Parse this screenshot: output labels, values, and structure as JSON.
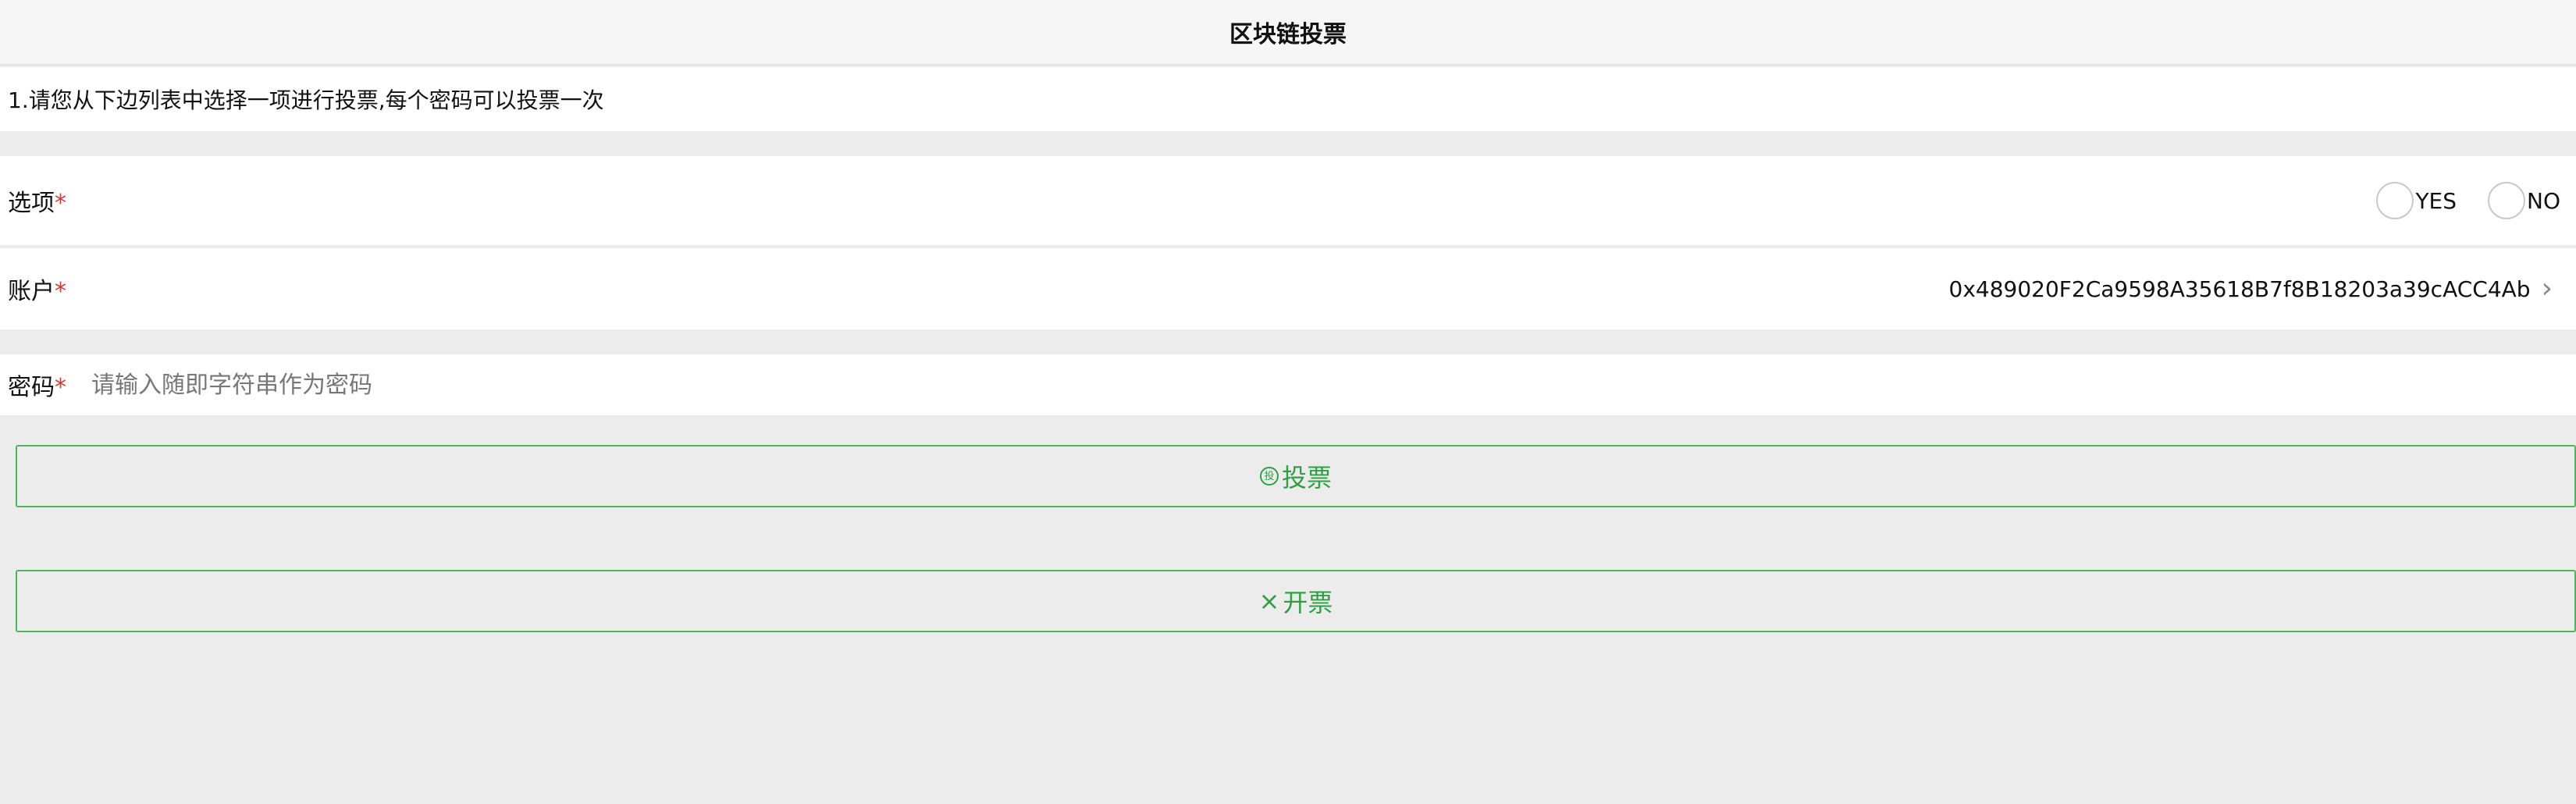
{
  "header": {
    "title": "区块链投票"
  },
  "notice": {
    "text": "1.请您从下边列表中选择一项进行投票,每个密码可以投票一次"
  },
  "form": {
    "option": {
      "label": "选项",
      "required_mark": "*",
      "choices": [
        {
          "label": "YES"
        },
        {
          "label": "NO"
        }
      ]
    },
    "account": {
      "label": "账户",
      "required_mark": "*",
      "value": "0x489020F2Ca9598A35618B7f8B18203a39cACC4Ab",
      "chevron": "›"
    },
    "password": {
      "label": "密码",
      "required_mark": "*",
      "placeholder": "请输入随即字符串作为密码",
      "value": ""
    }
  },
  "buttons": {
    "vote": {
      "icon_text": "投",
      "label": "投票"
    },
    "open": {
      "icon_text": "×",
      "label": "开票"
    }
  },
  "colors": {
    "accent_green": "#2ea043",
    "button_border": "#51b45a",
    "required_red": "#e0352b",
    "page_background": "#ececec"
  }
}
